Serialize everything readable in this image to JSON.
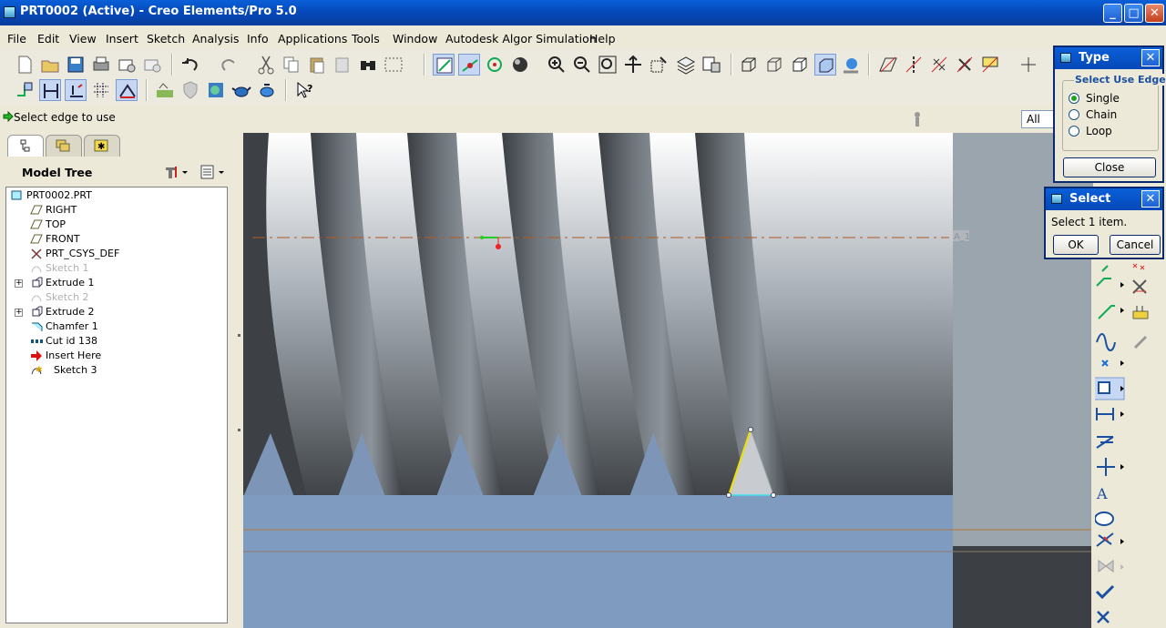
{
  "window": {
    "title": "PRT0002 (Active) - Creo Elements/Pro 5.0",
    "min_icon": "minimize-icon",
    "max_icon": "maximize-icon",
    "close_icon": "close-icon"
  },
  "menu": [
    "File",
    "Edit",
    "View",
    "Insert",
    "Sketch",
    "Analysis",
    "Info",
    "Applications",
    "Tools",
    "Window",
    "Autodesk Algor Simulation",
    "Help"
  ],
  "status": {
    "message": "Select edge to use",
    "filter": "All"
  },
  "model_tree": {
    "title": "Model Tree",
    "items": [
      {
        "label": "PRT0002.PRT",
        "icon": "part-icon",
        "dim": false,
        "expand": false
      },
      {
        "label": "RIGHT",
        "icon": "datum-plane-icon",
        "dim": false,
        "expand": false
      },
      {
        "label": "TOP",
        "icon": "datum-plane-icon",
        "dim": false,
        "expand": false
      },
      {
        "label": "FRONT",
        "icon": "datum-plane-icon",
        "dim": false,
        "expand": false
      },
      {
        "label": "PRT_CSYS_DEF",
        "icon": "csys-icon",
        "dim": false,
        "expand": false
      },
      {
        "label": "Sketch 1",
        "icon": "sketch-icon",
        "dim": true,
        "expand": false
      },
      {
        "label": "Extrude 1",
        "icon": "extrude-icon",
        "dim": false,
        "expand": true
      },
      {
        "label": "Sketch 2",
        "icon": "sketch-icon",
        "dim": true,
        "expand": false
      },
      {
        "label": "Extrude 2",
        "icon": "extrude-icon",
        "dim": false,
        "expand": true
      },
      {
        "label": "Chamfer 1",
        "icon": "chamfer-icon",
        "dim": false,
        "expand": false
      },
      {
        "label": "Cut id 138",
        "icon": "pattern-cut-icon",
        "dim": false,
        "expand": false
      },
      {
        "label": "Insert Here",
        "icon": "insert-arrow-icon",
        "dim": false,
        "expand": false
      },
      {
        "label": "Sketch 3",
        "icon": "sketch-active-icon",
        "dim": false,
        "expand": false
      }
    ]
  },
  "graphics": {
    "axis_label": "A_1"
  },
  "type_dialog": {
    "title": "Type",
    "group_label": "Select Use Edge",
    "options": [
      {
        "label": "Single",
        "selected": true
      },
      {
        "label": "Chain",
        "selected": false
      },
      {
        "label": "Loop",
        "selected": false
      }
    ],
    "close_label": "Close"
  },
  "select_dialog": {
    "title": "Select",
    "message": "Select 1 item.",
    "ok_label": "OK",
    "cancel_label": "Cancel"
  },
  "colors": {
    "titlebar": "#0548b8",
    "model_blue": "#7f9cc0",
    "highlight": "#f0e000"
  }
}
